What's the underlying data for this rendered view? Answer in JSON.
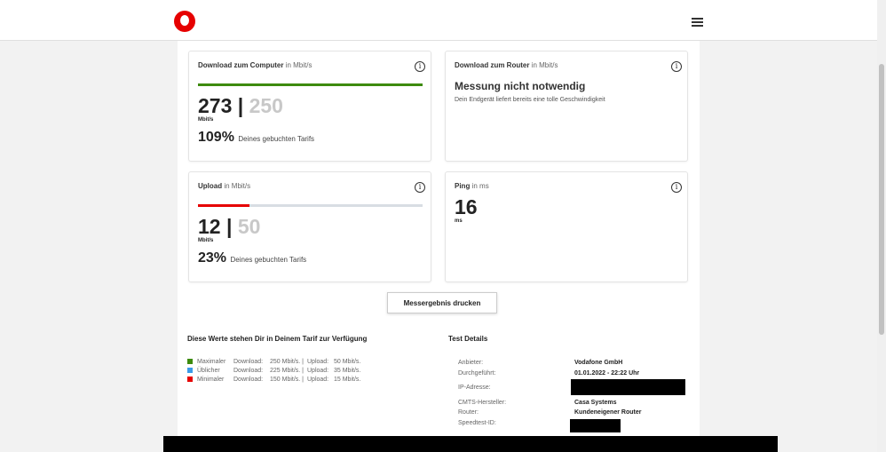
{
  "header": {
    "logo": "vodafone-logo",
    "menu_icon": "hamburger-icon"
  },
  "cards": {
    "download_pc": {
      "title": "Download zum Computer",
      "unit_suffix": "in Mbit/s",
      "measured": "273",
      "separator": "|",
      "booked": "250",
      "unit": "Mbit/s",
      "percent": "109%",
      "percent_text": "Deines gebuchten Tarifs",
      "progress": 1.0,
      "bar_color": "#3d8b0e"
    },
    "download_router": {
      "title": "Download zum Router",
      "unit_suffix": "in Mbit/s",
      "headline": "Messung nicht notwendig",
      "text": "Dein Endgerät liefert bereits eine tolle Geschwindigkeit"
    },
    "upload": {
      "title": "Upload",
      "unit_suffix": "in Mbit/s",
      "measured": "12",
      "separator": "|",
      "booked": "50",
      "unit": "Mbit/s",
      "percent": "23%",
      "percent_text": "Deines gebuchten Tarifs",
      "progress": 0.23,
      "bar_color": "#e60000"
    },
    "ping": {
      "title": "Ping",
      "unit_suffix": "in ms",
      "value": "16",
      "unit": "ms"
    }
  },
  "print_button": "Messergebnis drucken",
  "tariff": {
    "title": "Diese Werte stehen Dir in Deinem Tarif zur Verfügung",
    "rows": [
      {
        "color": "#3d8b0e",
        "name": "Maximaler",
        "dl_label": "Download:",
        "dl": "250 Mbit/s. |",
        "ul_label": "Upload:",
        "ul": "50 Mbit/s."
      },
      {
        "color": "#3b9be8",
        "name": "Üblicher",
        "dl_label": "Download:",
        "dl": "225 Mbit/s. |",
        "ul_label": "Upload:",
        "ul": "35 Mbit/s."
      },
      {
        "color": "#e60000",
        "name": "Minimaler",
        "dl_label": "Download:",
        "dl": "150 Mbit/s. |",
        "ul_label": "Upload:",
        "ul": "15 Mbit/s."
      }
    ]
  },
  "details": {
    "title": "Test Details",
    "rows": [
      {
        "label": "Anbieter:",
        "value": "Vodafone GmbH"
      },
      {
        "label": "Durchgeführt:",
        "value": "01.01.2022 - 22:22 Uhr"
      },
      {
        "label": "IP-Adresse:",
        "value": ""
      },
      {
        "label": "CMTS-Hersteller:",
        "value": "Casa Systems"
      },
      {
        "label": "Router:",
        "value": "Kundeneigener Router"
      },
      {
        "label": "Speedtest-ID:",
        "value": ""
      }
    ]
  }
}
